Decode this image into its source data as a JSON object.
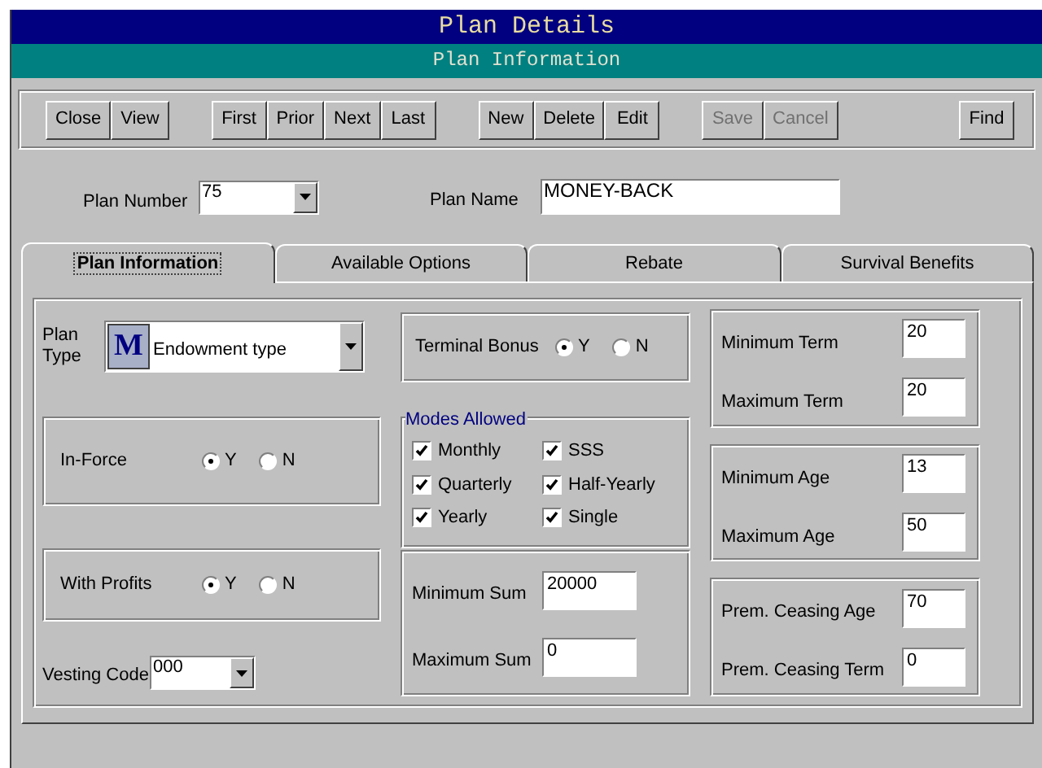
{
  "window": {
    "title": "Plan Details",
    "subtitle": "Plan Information"
  },
  "toolbar": [
    {
      "buttons": [
        {
          "label": "Close",
          "disabled": false
        },
        {
          "label": "View",
          "disabled": false
        }
      ]
    },
    {
      "buttons": [
        {
          "label": "First",
          "disabled": false
        },
        {
          "label": "Prior",
          "disabled": false
        },
        {
          "label": "Next",
          "disabled": false
        },
        {
          "label": "Last",
          "disabled": false
        }
      ]
    },
    {
      "buttons": [
        {
          "label": "New",
          "disabled": false
        },
        {
          "label": "Delete",
          "disabled": false
        },
        {
          "label": "Edit",
          "disabled": false
        }
      ]
    },
    {
      "buttons": [
        {
          "label": "Save",
          "disabled": true
        },
        {
          "label": "Cancel",
          "disabled": true
        }
      ]
    },
    {
      "buttons": [
        {
          "label": "Find",
          "disabled": false
        }
      ]
    }
  ],
  "plan_number": {
    "label": "Plan Number",
    "value": "75"
  },
  "plan_name": {
    "label": "Plan Name",
    "value": "MONEY-BACK"
  },
  "tabs": [
    {
      "label": "Plan Information",
      "selected": true
    },
    {
      "label": "Available Options",
      "selected": false
    },
    {
      "label": "Rebate",
      "selected": false
    },
    {
      "label": "Survival Benefits",
      "selected": false
    }
  ],
  "plan_type": {
    "label": "Plan Type",
    "icon_letter": "M",
    "value": "Endowment type"
  },
  "in_force": {
    "label": "In-Force",
    "options": [
      {
        "label": "Y",
        "selected": true
      },
      {
        "label": "N",
        "selected": false
      }
    ]
  },
  "with_profits": {
    "label": "With Profits",
    "options": [
      {
        "label": "Y",
        "selected": true
      },
      {
        "label": "N",
        "selected": false
      }
    ]
  },
  "vesting_code": {
    "label": "Vesting Code",
    "value": "000"
  },
  "terminal_bonus": {
    "label": "Terminal Bonus",
    "options": [
      {
        "label": "Y",
        "selected": true
      },
      {
        "label": "N",
        "selected": false
      }
    ]
  },
  "modes_allowed": {
    "title": "Modes Allowed",
    "modes": [
      {
        "label": "Monthly",
        "checked": true
      },
      {
        "label": "SSS",
        "checked": true
      },
      {
        "label": "Quarterly",
        "checked": true
      },
      {
        "label": "Half-Yearly",
        "checked": true
      },
      {
        "label": "Yearly",
        "checked": true
      },
      {
        "label": "Single",
        "checked": true
      }
    ]
  },
  "sums": [
    {
      "label": "Minimum Sum",
      "value": "20000"
    },
    {
      "label": "Maximum Sum",
      "value": "0"
    }
  ],
  "terms": [
    {
      "label": "Minimum Term",
      "value": "20"
    },
    {
      "label": "Maximum Term",
      "value": "20"
    }
  ],
  "ages": [
    {
      "label": "Minimum Age",
      "value": "13"
    },
    {
      "label": "Maximum Age",
      "value": "50"
    }
  ],
  "premium": [
    {
      "label": "Prem. Ceasing Age",
      "value": "70"
    },
    {
      "label": "Prem. Ceasing Term",
      "value": "0"
    }
  ]
}
